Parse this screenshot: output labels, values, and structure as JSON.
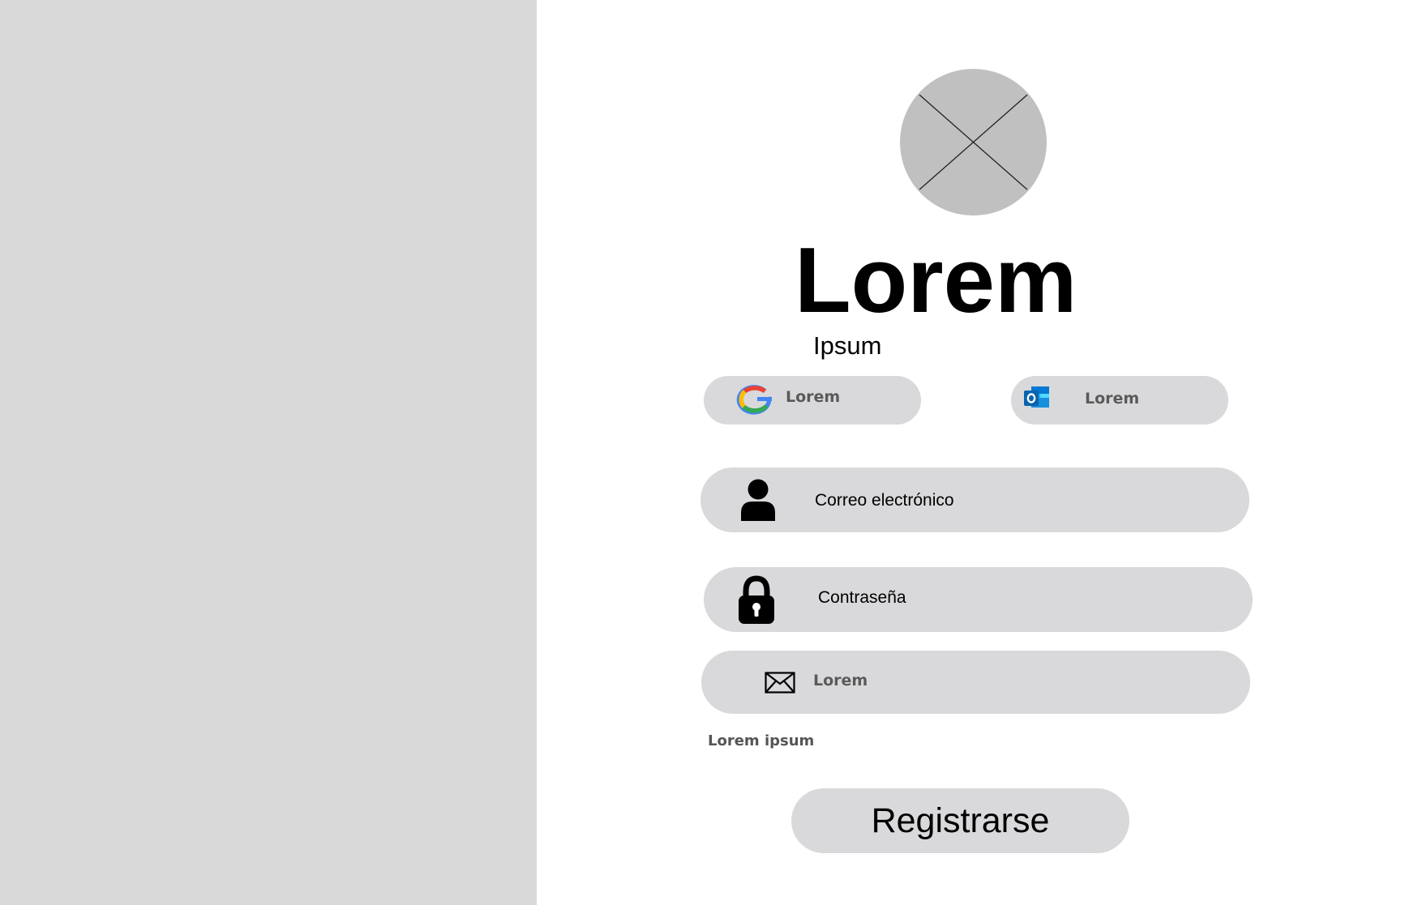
{
  "hero": {
    "title": "Lorem",
    "subtitle": "Ipsum"
  },
  "social_buttons": {
    "google": {
      "label": "Lorem",
      "icon": "google-logo-icon"
    },
    "outlook": {
      "label": "Lorem",
      "icon": "outlook-logo-icon"
    }
  },
  "fields": {
    "email": {
      "placeholder": "Correo electrónico",
      "icon": "user-icon"
    },
    "password": {
      "placeholder": "Contraseña",
      "icon": "lock-icon"
    },
    "extra": {
      "placeholder": "Lorem",
      "icon": "envelope-icon"
    }
  },
  "link_text": "Lorem ipsum",
  "register_label": "Registrarse",
  "colors": {
    "left_panel": "#d9d9d9",
    "pill": "#d9d9db",
    "avatar_placeholder": "#c0c0c0",
    "secondary_text": "#5a5a5a"
  }
}
